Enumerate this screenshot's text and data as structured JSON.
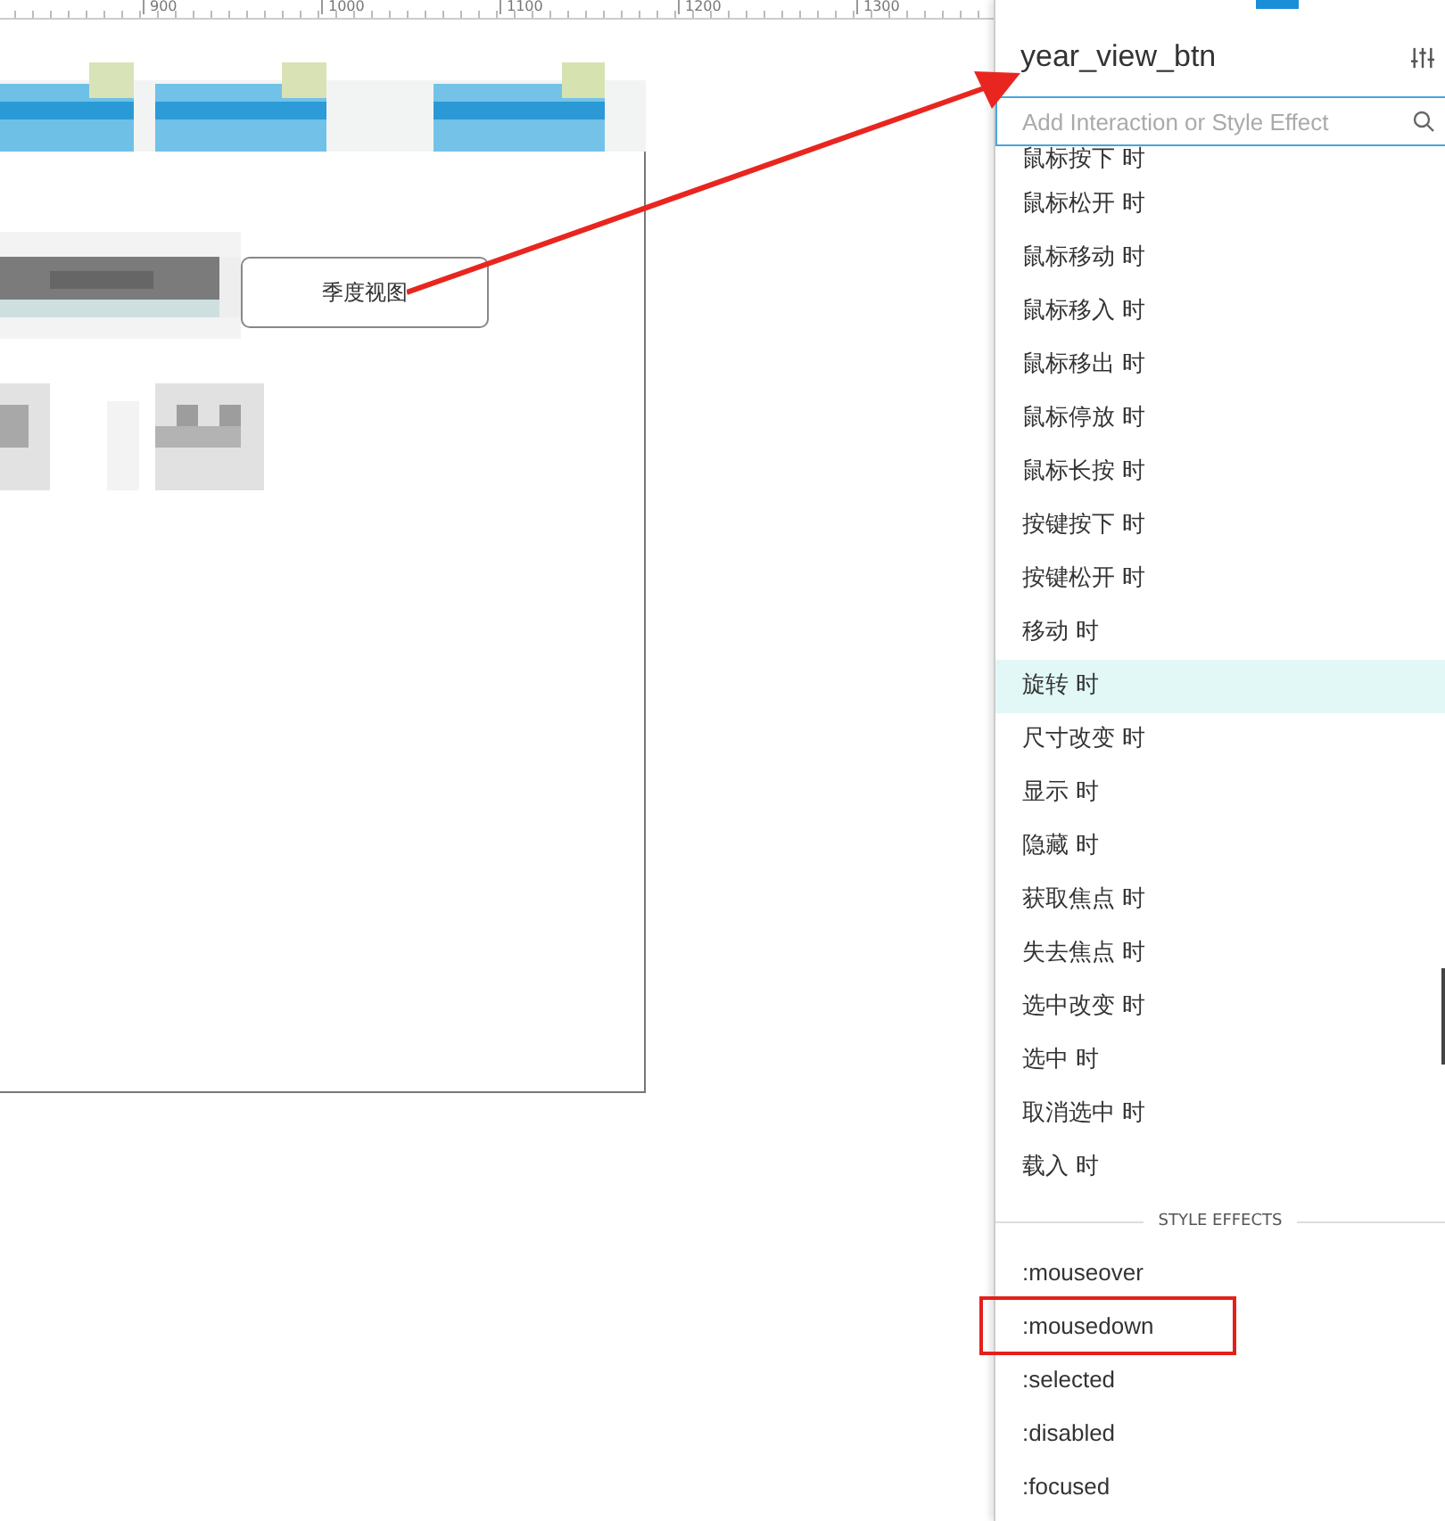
{
  "ruler": {
    "labels": [
      "900",
      "1000",
      "1100",
      "1200",
      "1300"
    ]
  },
  "canvas": {
    "button": {
      "label": "季度视图"
    }
  },
  "panel": {
    "title": "year_view_btn",
    "search": {
      "placeholder": "Add Interaction or Style Effect"
    },
    "events": [
      {
        "label": "鼠标按下 时",
        "selected": false
      },
      {
        "label": "鼠标松开 时",
        "selected": false
      },
      {
        "label": "鼠标移动 时",
        "selected": false
      },
      {
        "label": "鼠标移入 时",
        "selected": false
      },
      {
        "label": "鼠标移出 时",
        "selected": false
      },
      {
        "label": "鼠标停放 时",
        "selected": false
      },
      {
        "label": "鼠标长按 时",
        "selected": false
      },
      {
        "label": "按键按下 时",
        "selected": false
      },
      {
        "label": "按键松开 时",
        "selected": false
      },
      {
        "label": "移动 时",
        "selected": false
      },
      {
        "label": "旋转 时",
        "selected": true
      },
      {
        "label": "尺寸改变 时",
        "selected": false
      },
      {
        "label": "显示 时",
        "selected": false
      },
      {
        "label": "隐藏 时",
        "selected": false
      },
      {
        "label": "获取焦点 时",
        "selected": false
      },
      {
        "label": "失去焦点 时",
        "selected": false
      },
      {
        "label": "选中改变 时",
        "selected": false
      },
      {
        "label": "选中 时",
        "selected": false
      },
      {
        "label": "取消选中 时",
        "selected": false
      },
      {
        "label": "载入 时",
        "selected": false
      }
    ],
    "style_effects_heading": "STYLE EFFECTS",
    "style_effects": [
      {
        "label": ":mouseover",
        "annotated": false
      },
      {
        "label": ":mousedown",
        "annotated": true
      },
      {
        "label": ":selected",
        "annotated": false
      },
      {
        "label": ":disabled",
        "annotated": false
      },
      {
        "label": ":focused",
        "annotated": false
      }
    ]
  }
}
